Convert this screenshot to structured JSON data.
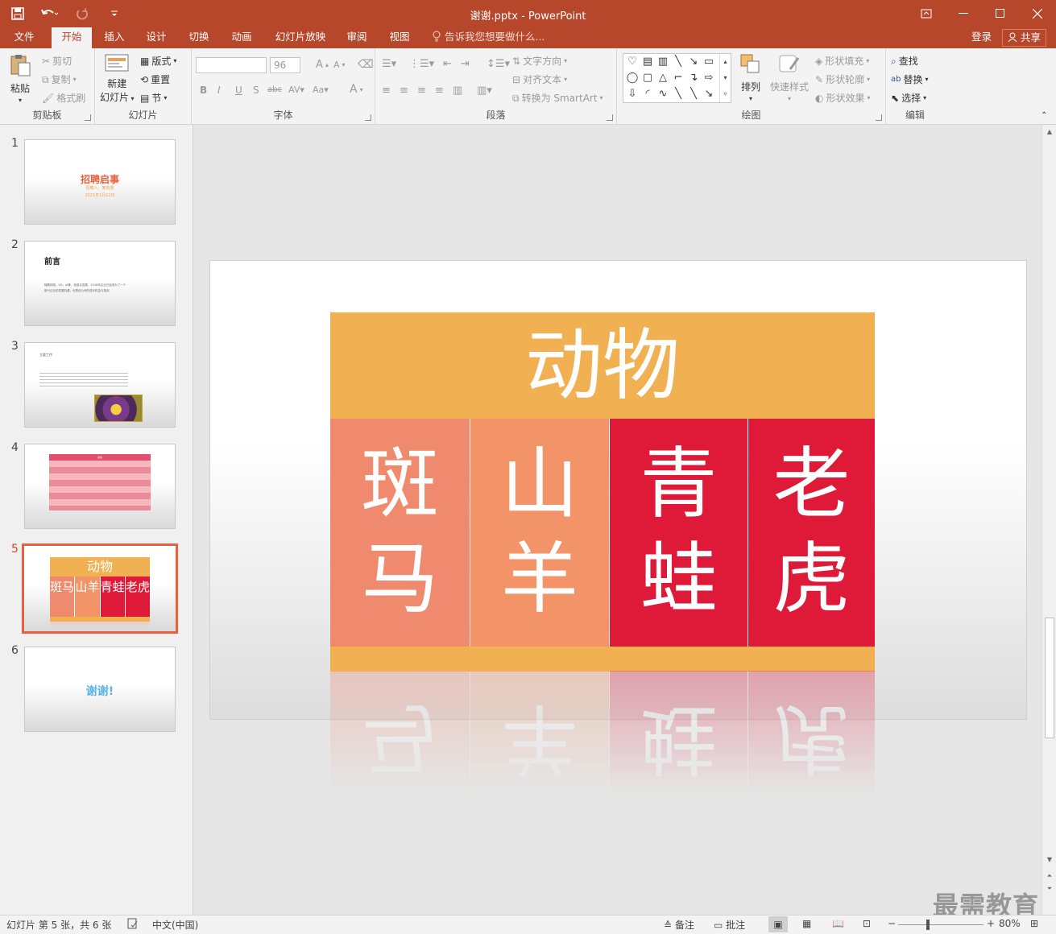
{
  "window": {
    "title": "谢谢.pptx - PowerPoint"
  },
  "quick_access": {
    "save_icon": "save-icon",
    "undo_icon": "undo-icon",
    "redo_icon": "redo-icon",
    "customize_icon": "customize-icon"
  },
  "tabs": [
    "文件",
    "开始",
    "插入",
    "设计",
    "切换",
    "动画",
    "幻灯片放映",
    "审阅",
    "视图"
  ],
  "active_tab": "开始",
  "tellme": "告诉我您想要做什么...",
  "login": "登录",
  "share": "共享",
  "ribbon": {
    "clipboard": {
      "label": "剪贴板",
      "paste": "粘贴",
      "cut": "剪切",
      "copy": "复制",
      "format_painter": "格式刷"
    },
    "slides": {
      "label": "幻灯片",
      "new_slide_line1": "新建",
      "new_slide_line2": "幻灯片",
      "layout": "版式",
      "reset": "重置",
      "section": "节"
    },
    "font": {
      "label": "字体",
      "font_name": "",
      "font_size": "96"
    },
    "paragraph": {
      "label": "段落",
      "text_direction": "文字方向",
      "align_text": "对齐文本",
      "smartart": "转换为 SmartArt"
    },
    "drawing": {
      "label": "绘图",
      "arrange": "排列",
      "quick_styles": "快速样式",
      "shape_fill": "形状填充",
      "shape_outline": "形状轮廓",
      "shape_effects": "形状效果"
    },
    "editing": {
      "label": "编辑",
      "find": "查找",
      "replace": "替换",
      "select": "选择"
    }
  },
  "thumbnails": [
    {
      "num": "1",
      "title": "招聘启事",
      "sub1": "招聘人：某有限",
      "sub2": "2021年1月12日"
    },
    {
      "num": "2",
      "title": "前言",
      "body1": "随着网络、5G、AI等，信息化发展，2018年企业已经成为了一个",
      "body2": "新兴企业的发展机遇，也是该公司的成长机会与挑战"
    },
    {
      "num": "3",
      "title": "主要工作"
    },
    {
      "num": "4",
      "title": "表格"
    },
    {
      "num": "5",
      "head": "动物",
      "cells": [
        "斑马",
        "山羊",
        "青蛙",
        "老虎"
      ]
    },
    {
      "num": "6",
      "title": "谢谢!"
    }
  ],
  "slide": {
    "heading": "动物",
    "cells": [
      {
        "line1": "斑",
        "line2": "马",
        "color": "#ef8a6e"
      },
      {
        "line1": "山",
        "line2": "羊",
        "color": "#f29468"
      },
      {
        "line1": "青",
        "line2": "蛙",
        "color": "#df1a38"
      },
      {
        "line1": "老",
        "line2": "虎",
        "color": "#df1a38"
      }
    ],
    "band_color": "#f1b153"
  },
  "status": {
    "slide_info": "幻灯片 第 5 张，共 6 张",
    "language": "中文(中国)",
    "notes": "备注",
    "comments": "批注",
    "zoom": "80%"
  },
  "watermark": "最需教育",
  "colors": {
    "accent": "#b7472a",
    "selected_thumb": "#e8603e"
  }
}
